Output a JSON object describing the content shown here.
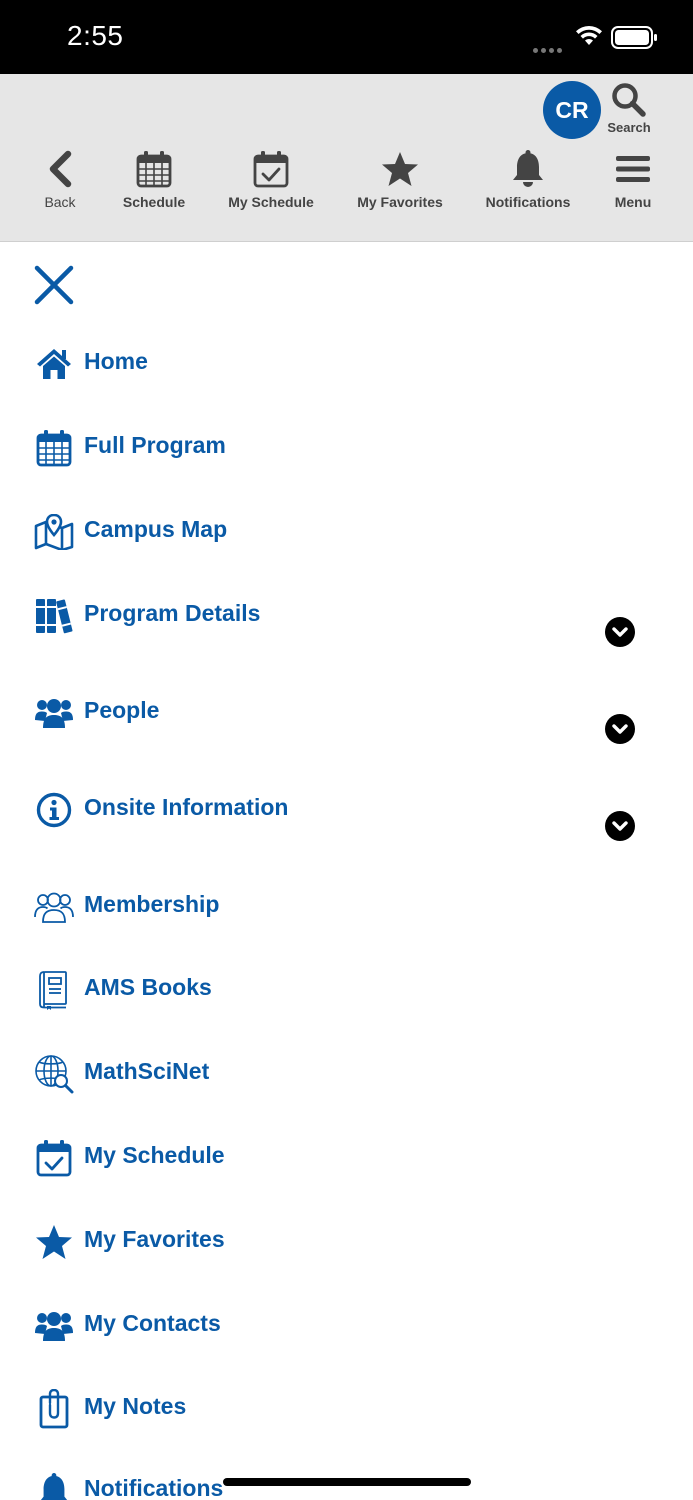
{
  "status_bar": {
    "time": "2:55"
  },
  "toolbar": {
    "avatar_initials": "CR",
    "search_label": "Search",
    "nav": [
      {
        "label": "Back",
        "icon": "chevron-left-icon"
      },
      {
        "label": "Schedule",
        "icon": "calendar-icon"
      },
      {
        "label": "My Schedule",
        "icon": "calendar-check-icon"
      },
      {
        "label": "My Favorites",
        "icon": "star-icon"
      },
      {
        "label": "Notifications",
        "icon": "bell-icon"
      },
      {
        "label": "Menu",
        "icon": "hamburger-icon"
      }
    ]
  },
  "menu": {
    "items": [
      {
        "label": "Home",
        "icon": "home-icon"
      },
      {
        "label": "Full Program",
        "icon": "calendar-icon"
      },
      {
        "label": "Campus Map",
        "icon": "map-icon"
      },
      {
        "label": "Program Details",
        "icon": "books-icon",
        "expandable": true
      },
      {
        "label": "People",
        "icon": "people-icon",
        "expandable": true
      },
      {
        "label": "Onsite Information",
        "icon": "info-icon",
        "expandable": true
      },
      {
        "label": "Membership",
        "icon": "membership-icon"
      },
      {
        "label": "AMS Books",
        "icon": "book-icon"
      },
      {
        "label": "MathSciNet",
        "icon": "globe-search-icon"
      },
      {
        "label": "My Schedule",
        "icon": "calendar-check-icon"
      },
      {
        "label": "My Favorites",
        "icon": "star-icon"
      },
      {
        "label": "My Contacts",
        "icon": "people-icon"
      },
      {
        "label": "My Notes",
        "icon": "clipboard-clip-icon"
      },
      {
        "label": "Notifications",
        "icon": "bell-icon"
      }
    ]
  },
  "colors": {
    "accent": "#0a5aa6",
    "toolbar_bg": "#e6e6e6",
    "toolbar_icon": "#444444"
  }
}
